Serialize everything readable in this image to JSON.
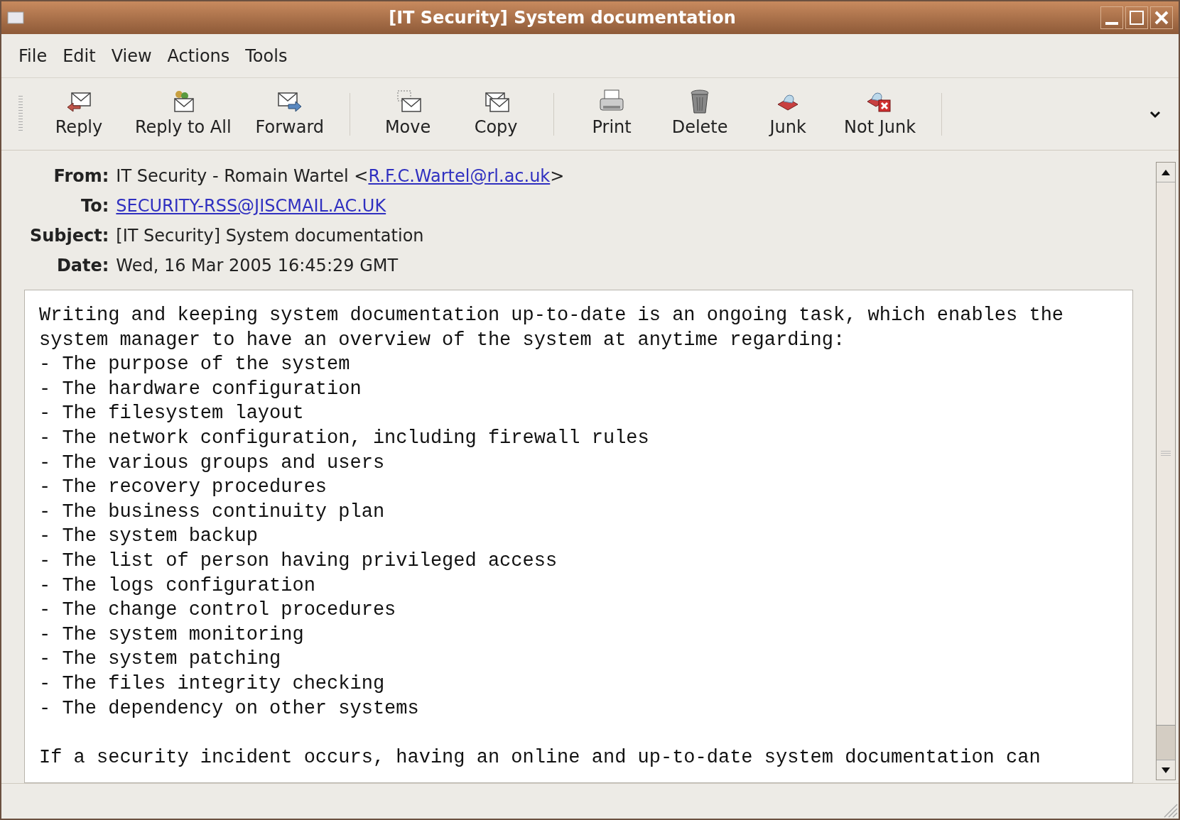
{
  "window": {
    "title": "[IT Security] System documentation"
  },
  "menu": [
    "File",
    "Edit",
    "View",
    "Actions",
    "Tools"
  ],
  "toolbar": [
    [
      "Reply",
      "Reply to All",
      "Forward"
    ],
    [
      "Move",
      "Copy"
    ],
    [
      "Print",
      "Delete",
      "Junk",
      "Not Junk"
    ]
  ],
  "headers": [
    {
      "label": "From:",
      "value": "IT Security - Romain Wartel <",
      "link": "R.F.C.Wartel@rl.ac.uk",
      "after": ">"
    },
    {
      "label": "To:",
      "link": "SECURITY-RSS@JISCMAIL.AC.UK"
    },
    {
      "label": "Subject:",
      "value": "[IT Security] System documentation"
    },
    {
      "label": "Date:",
      "value": "Wed, 16 Mar 2005 16:45:29 GMT"
    }
  ],
  "body": [
    [
      "Writing and keeping system documentation up-to-date is an ongoing task, which enables the",
      "system manager to have an overview of the system at anytime regarding:",
      "- The purpose of the system",
      "- The hardware configuration",
      "- The filesystem layout",
      "- The network configuration, including firewall rules",
      "- The various groups and users",
      "- The recovery procedures",
      "- The business continuity plan",
      "- The system backup",
      "- The list of person having privileged access",
      "- The logs configuration",
      "- The change control procedures",
      "- The system monitoring",
      "- The system patching",
      "- The files integrity checking",
      "- The dependency on other systems"
    ],
    [
      "If a security incident occurs, having an online and up-to-date system documentation can"
    ]
  ]
}
